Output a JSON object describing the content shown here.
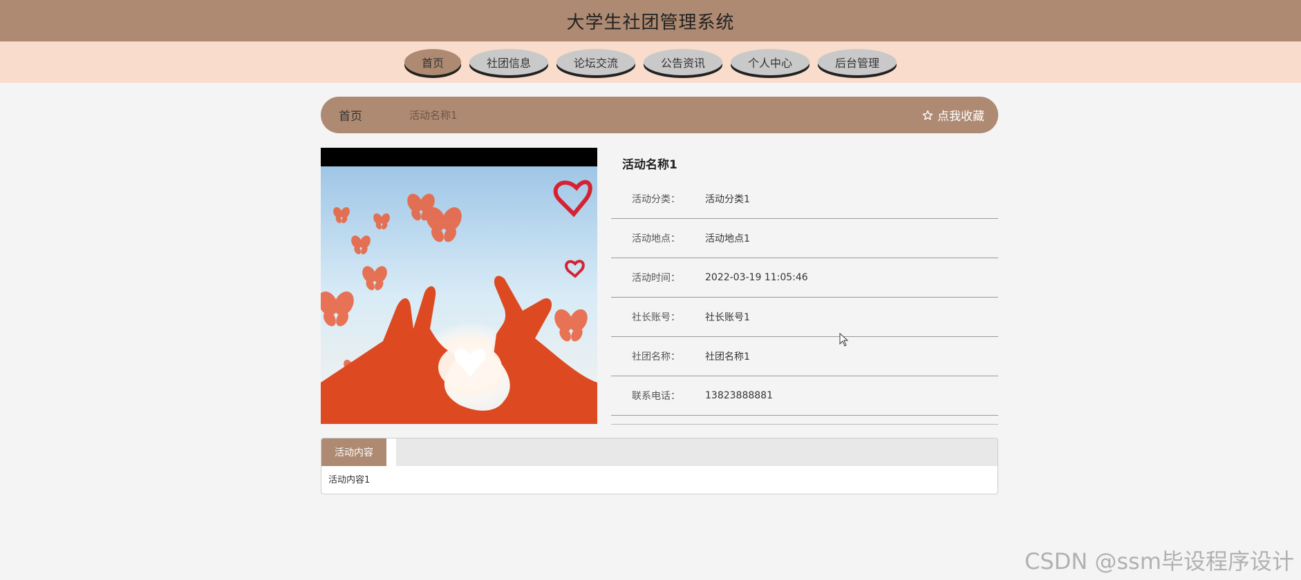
{
  "header": {
    "title": "大学生社团管理系统"
  },
  "nav": {
    "items": [
      {
        "label": "首页"
      },
      {
        "label": "社团信息"
      },
      {
        "label": "论坛交流"
      },
      {
        "label": "公告资讯"
      },
      {
        "label": "个人中心"
      },
      {
        "label": "后台管理"
      }
    ],
    "active_index": 0
  },
  "breadcrumb": {
    "home": "首页",
    "current": "活动名称1",
    "collect_label": "点我收藏",
    "collect_icon": "star-icon"
  },
  "detail": {
    "name": "活动名称1",
    "rows": [
      {
        "label": "活动分类：",
        "value": "活动分类1"
      },
      {
        "label": "活动地点：",
        "value": "活动地点1"
      },
      {
        "label": "活动时间：",
        "value": "2022-03-19 11:05:46"
      },
      {
        "label": "社长账号：",
        "value": "社长账号1"
      },
      {
        "label": "社团名称：",
        "value": "社团名称1"
      },
      {
        "label": "联系电话：",
        "value": "13823888881"
      }
    ]
  },
  "content": {
    "tab_label": "活动内容",
    "text": "活动内容1"
  },
  "watermark": "CSDN @ssm毕设程序设计",
  "colors": {
    "brand": "#ae8a72",
    "nav_band": "#f9dccb",
    "nav_button": "#c9c9c9"
  }
}
